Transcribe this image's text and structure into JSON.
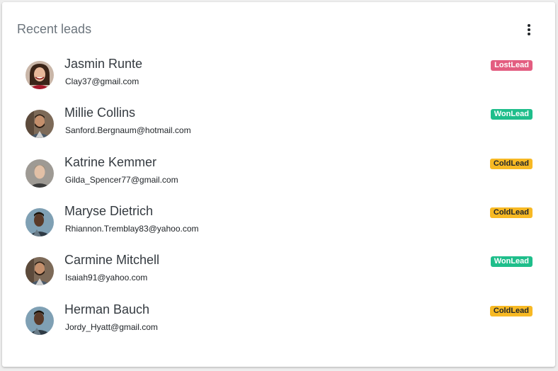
{
  "card": {
    "title": "Recent leads",
    "menu_icon": "more-vertical-icon"
  },
  "colors": {
    "lost": "#e35d80",
    "won": "#1fbe8b",
    "cold": "#f7b924"
  },
  "leads": [
    {
      "name": "Jasmin Runte",
      "email": "Clay37@gmail.com",
      "status": "LostLead",
      "status_type": "lost",
      "avatar": "avatar-woman-smiling"
    },
    {
      "name": "Millie Collins",
      "email": "Sanford.Bergnaum@hotmail.com",
      "status": "WonLead",
      "status_type": "won",
      "avatar": "avatar-man-bearded"
    },
    {
      "name": "Katrine Kemmer",
      "email": "Gilda_Spencer77@gmail.com",
      "status": "ColdLead",
      "status_type": "cold",
      "avatar": "avatar-man-blonde"
    },
    {
      "name": "Maryse Dietrich",
      "email": "Rhiannon.Tremblay83@yahoo.com",
      "status": "ColdLead",
      "status_type": "cold",
      "avatar": "avatar-man-dark"
    },
    {
      "name": "Carmine Mitchell",
      "email": "Isaiah91@yahoo.com",
      "status": "WonLead",
      "status_type": "won",
      "avatar": "avatar-man-bearded"
    },
    {
      "name": "Herman Bauch",
      "email": "Jordy_Hyatt@gmail.com",
      "status": "ColdLead",
      "status_type": "cold",
      "avatar": "avatar-man-dark"
    }
  ]
}
